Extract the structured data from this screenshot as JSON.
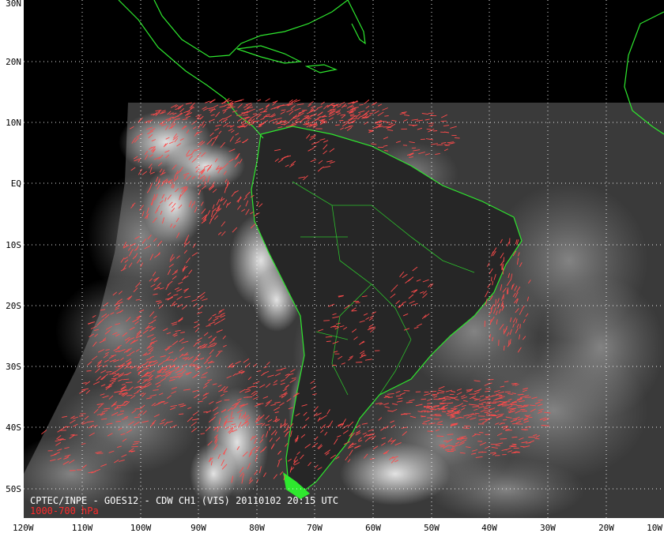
{
  "map": {
    "caption_line1": "CPTEC/INPE - GOES12 - CDW CH1 (VIS) 20110102 20:15 UTC",
    "caption_line2": "1000-700 hPa",
    "lat_labels": [
      "30N",
      "20N",
      "10N",
      "EQ",
      "10S",
      "20S",
      "30S",
      "40S",
      "50S"
    ],
    "lon_labels": [
      "120W",
      "110W",
      "100W",
      "90W",
      "80W",
      "70W",
      "60W",
      "50W",
      "40W",
      "30W",
      "20W",
      "10W"
    ],
    "colors": {
      "background": "#000000",
      "frame": "#ffffff",
      "coastline": "#2ee82e",
      "wind_vectors": "#ff4b4b",
      "grid": "#ffffff",
      "caption_main": "#ffffff",
      "caption_level": "#ff2a2a"
    }
  }
}
